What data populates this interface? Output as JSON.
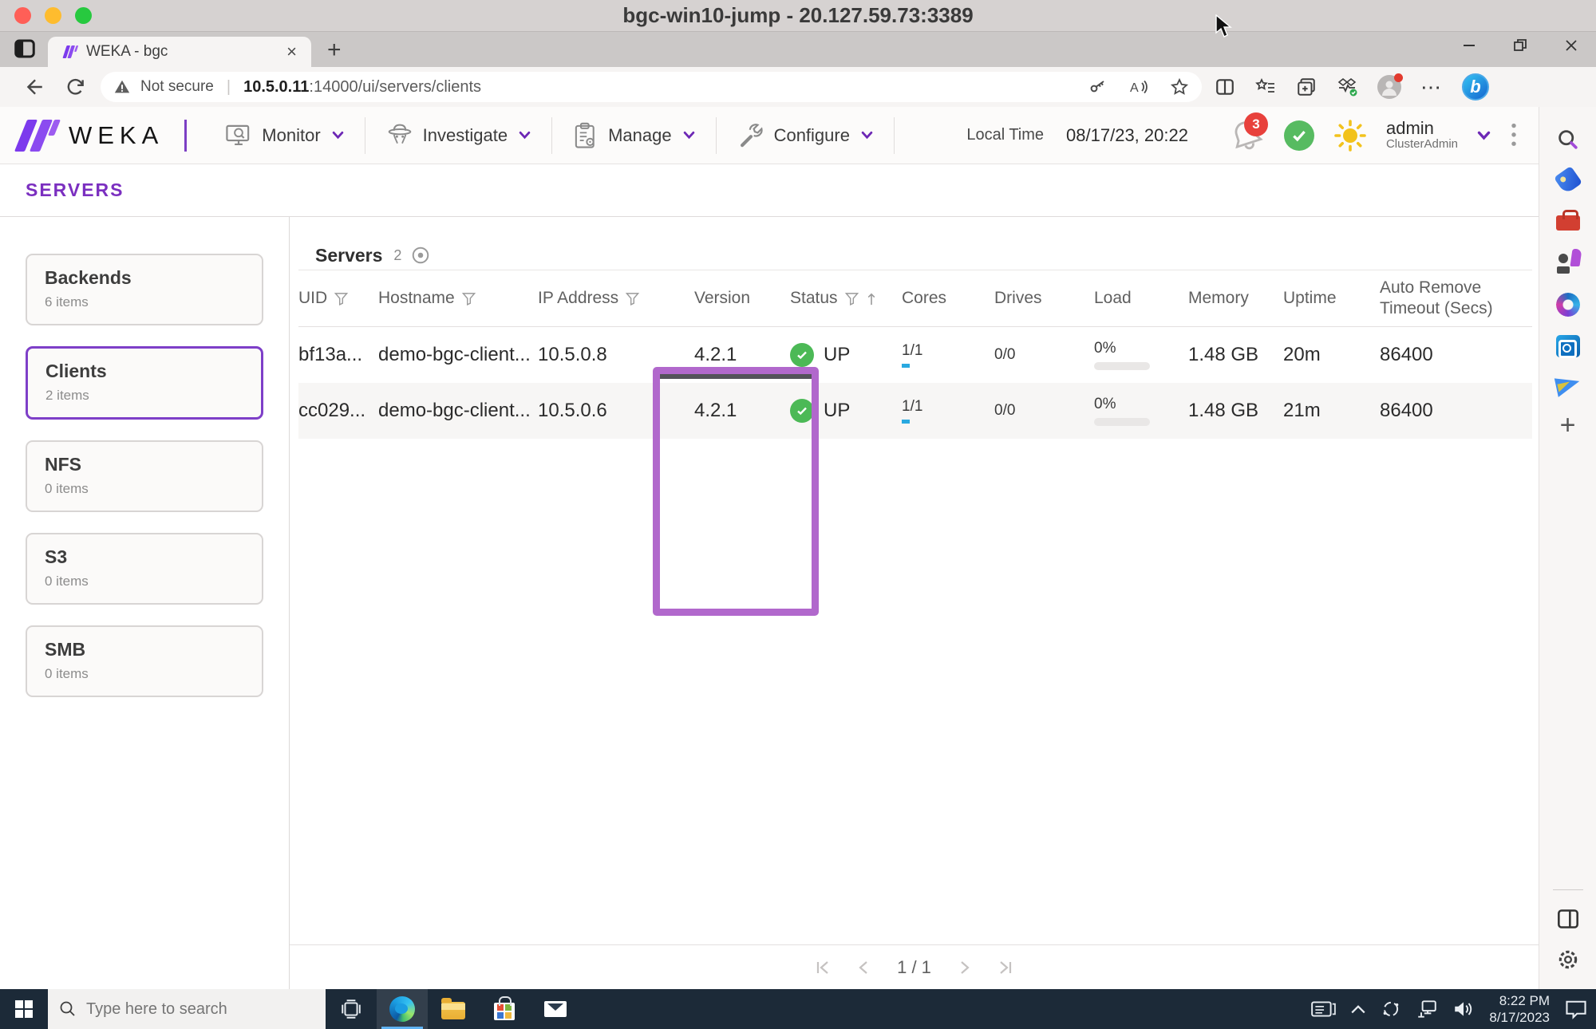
{
  "window": {
    "title": "bgc-win10-jump - 20.127.59.73:3389"
  },
  "browser": {
    "tab": {
      "title": "WEKA - bgc"
    },
    "address": {
      "security": "Not secure",
      "url_host": "10.5.0.11",
      "url_path": ":14000/ui/servers/clients"
    }
  },
  "icons": {
    "plus": "+",
    "close": "×",
    "ellipsis": "⋯",
    "chevron_up": "⌃"
  },
  "header": {
    "brand": "WEKA",
    "nav": [
      {
        "label": "Monitor"
      },
      {
        "label": "Investigate"
      },
      {
        "label": "Manage"
      },
      {
        "label": "Configure"
      }
    ],
    "local_time_label": "Local Time",
    "local_time_value": "08/17/23, 20:22",
    "notifications_count": "3",
    "user": {
      "name": "admin",
      "role": "ClusterAdmin"
    }
  },
  "page": {
    "title": "SERVERS"
  },
  "sidebar": {
    "cards": [
      {
        "label": "Backends",
        "count": "6 items"
      },
      {
        "label": "Clients",
        "count": "2 items"
      },
      {
        "label": "NFS",
        "count": "0 items"
      },
      {
        "label": "S3",
        "count": "0 items"
      },
      {
        "label": "SMB",
        "count": "0 items"
      }
    ]
  },
  "table": {
    "title": "Servers",
    "count": "2",
    "columns": [
      "UID",
      "Hostname",
      "IP Address",
      "Version",
      "Status",
      "Cores",
      "Drives",
      "Load",
      "Memory",
      "Uptime",
      "Auto Remove Timeout (Secs)"
    ],
    "rows": [
      {
        "uid": "bf13a...",
        "hostname": "demo-bgc-client...",
        "ip": "10.5.0.8",
        "version": "4.2.1",
        "status": "UP",
        "cores": "1/1",
        "drives": "0/0",
        "load": "0%",
        "memory": "1.48 GB",
        "uptime": "20m",
        "auto_remove": "86400"
      },
      {
        "uid": "cc029...",
        "hostname": "demo-bgc-client...",
        "ip": "10.5.0.6",
        "version": "4.2.1",
        "status": "UP",
        "cores": "1/1",
        "drives": "0/0",
        "load": "0%",
        "memory": "1.48 GB",
        "uptime": "21m",
        "auto_remove": "86400"
      }
    ],
    "pagination": "1 / 1"
  },
  "taskbar": {
    "search_placeholder": "Type here to search",
    "clock_time": "8:22 PM",
    "clock_date": "8/17/2023"
  },
  "colors": {
    "accent_purple": "#7b3fc4",
    "highlight_purple": "#b168cc",
    "status_green": "#4cb956",
    "badge_red": "#e8413c",
    "cores_blue": "#29a9e0"
  }
}
